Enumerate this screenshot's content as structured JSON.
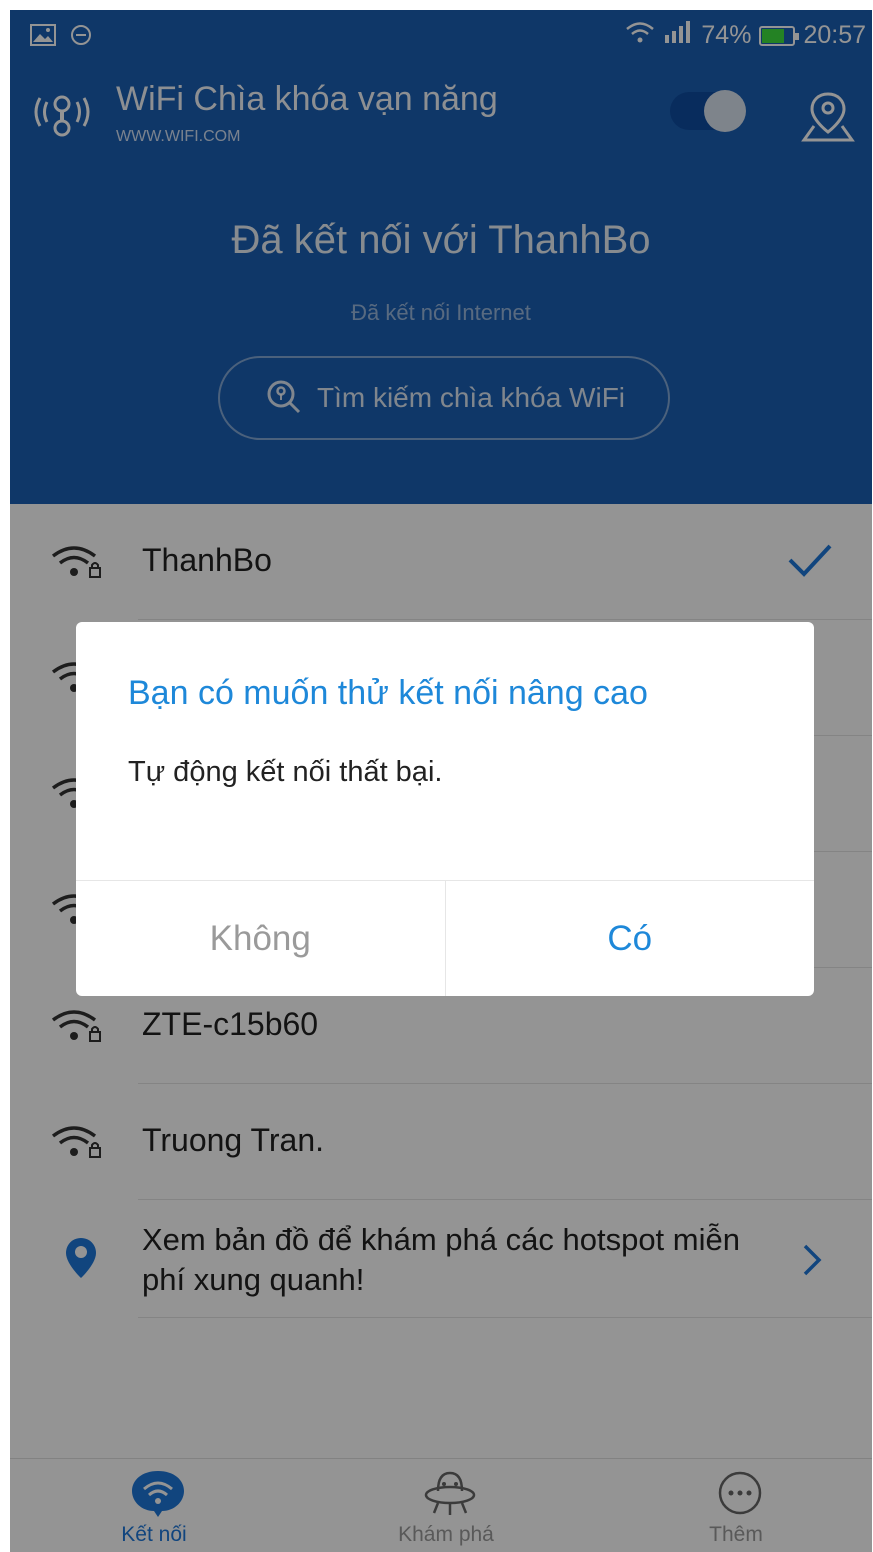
{
  "status_bar": {
    "battery_percent": "74%",
    "battery_level": 0.74,
    "time": "20:57",
    "icons": [
      "image-icon",
      "minus-circle-icon",
      "wifi-signal-icon",
      "cell-signal-icon",
      "battery-icon"
    ]
  },
  "app": {
    "title": "WiFi Chìa khóa vạn năng",
    "url": "WWW.WIFI.COM",
    "auto_toggle_on": true
  },
  "hero": {
    "connected_title": "Đã kết nối với ThanhBo",
    "internet_status": "Đã kết nối Internet",
    "search_button_label": "Tìm kiếm chìa khóa WiFi"
  },
  "networks": [
    {
      "name": "ThanhBo",
      "connected": true
    },
    {
      "name": "",
      "connected": false
    },
    {
      "name": "",
      "connected": false
    },
    {
      "name": "",
      "connected": false
    },
    {
      "name": "ZTE-c15b60",
      "connected": false
    },
    {
      "name": "Truong Tran.",
      "connected": false
    }
  ],
  "map_hint": {
    "text": "Xem bản đồ để khám phá các hotspot miễn phí xung quanh!"
  },
  "bottom_nav": [
    {
      "label": "Kết nối",
      "icon": "wifi-bubble-icon",
      "active": true
    },
    {
      "label": "Khám phá",
      "icon": "ufo-icon",
      "active": false
    },
    {
      "label": "Thêm",
      "icon": "more-dots-icon",
      "active": false
    }
  ],
  "dialog": {
    "title": "Bạn có muốn thử kết nối nâng cao",
    "message": "Tự động kết nối thất bại.",
    "cancel_label": "Không",
    "confirm_label": "Có"
  },
  "colors": {
    "header_blue": "#1a5fb4",
    "accent_blue": "#1e88d9",
    "battery_green": "#3ee03e",
    "overlay": "rgba(0,0,0,0.42)"
  }
}
